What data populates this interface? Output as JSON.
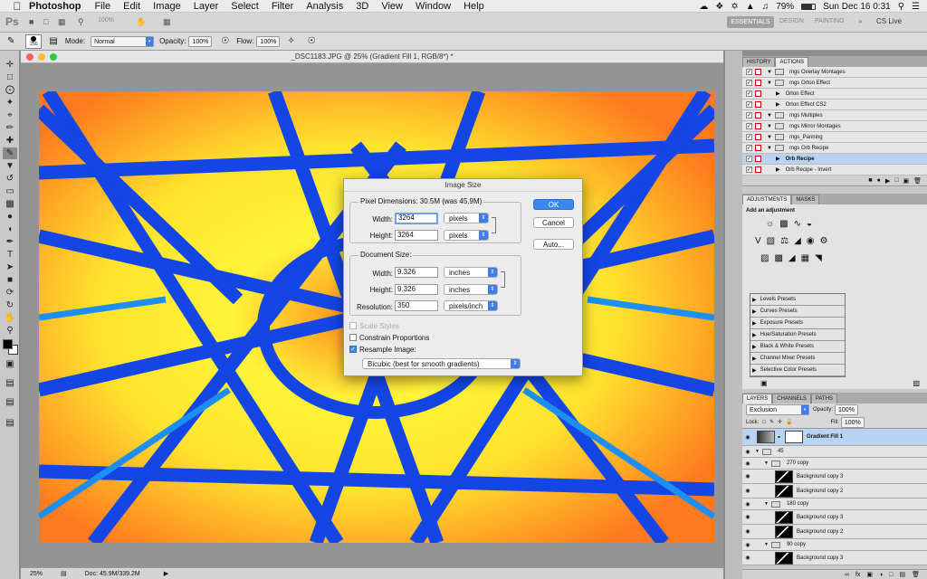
{
  "menubar": {
    "app_name": "Photoshop",
    "items": [
      "File",
      "Edit",
      "Image",
      "Layer",
      "Select",
      "Filter",
      "Analysis",
      "3D",
      "View",
      "Window",
      "Help"
    ],
    "battery": "79%",
    "clock": "Sun Dec 16  0:31"
  },
  "appbar": {
    "ps_logo": "Ps",
    "zoom": "100%",
    "workspaces": [
      "ESSENTIALS",
      "DESIGN",
      "PAINTING"
    ],
    "overflow": "»",
    "cslive": "CS Live"
  },
  "options": {
    "brush_size": "250",
    "mode_label": "Mode:",
    "mode_value": "Normal",
    "opacity_label": "Opacity:",
    "opacity_value": "100%",
    "flow_label": "Flow:",
    "flow_value": "100%"
  },
  "document": {
    "title": "_DSC1183.JPG @ 25% (Gradient Fill 1, RGB/8*) *",
    "zoom": "25%",
    "doc_info": "Doc: 45.9M/339.2M"
  },
  "history_panel": {
    "tabs": [
      "HISTORY",
      "ACTIONS"
    ],
    "rows": [
      {
        "label": "mgs Overlay Montages",
        "level": 0,
        "selected": false
      },
      {
        "label": "mgs Orton Effect",
        "level": 0,
        "selected": false
      },
      {
        "label": "Orton Effect",
        "level": 1,
        "selected": false
      },
      {
        "label": "Orton Effect CS2",
        "level": 1,
        "selected": false
      },
      {
        "label": "mgs Multiples",
        "level": 0,
        "selected": false
      },
      {
        "label": "mgs Mirror Montages",
        "level": 0,
        "selected": false
      },
      {
        "label": "mgs_Panning",
        "level": 0,
        "selected": false
      },
      {
        "label": "mgs Orb Recipe",
        "level": 0,
        "selected": false
      },
      {
        "label": "Orb Recipe",
        "level": 1,
        "selected": true
      },
      {
        "label": "Orb Recipe - Invert",
        "level": 1,
        "selected": false
      }
    ]
  },
  "adjustments_panel": {
    "tabs": [
      "ADJUSTMENTS",
      "MASKS"
    ],
    "heading": "Add an adjustment",
    "presets": [
      "Levels Presets",
      "Curves Presets",
      "Exposure Presets",
      "Hue/Saturation Presets",
      "Black & White Presets",
      "Channel Mixer Presets",
      "Selective Color Presets"
    ]
  },
  "layers_panel": {
    "tabs": [
      "LAYERS",
      "CHANNELS",
      "PATHS"
    ],
    "blend_mode": "Exclusion",
    "opacity_label": "Opacity:",
    "opacity_value": "100%",
    "lock_label": "Lock:",
    "fill_label": "Fill:",
    "fill_value": "100%",
    "layers": [
      {
        "name": "Gradient Fill 1",
        "type": "fill",
        "indent": 0,
        "selected": true
      },
      {
        "name": "45",
        "type": "group",
        "indent": 0,
        "selected": false
      },
      {
        "name": "270 copy",
        "type": "group",
        "indent": 1,
        "selected": false
      },
      {
        "name": "Background copy 3",
        "type": "layer",
        "indent": 2,
        "selected": false
      },
      {
        "name": "Background copy 2",
        "type": "layer",
        "indent": 2,
        "selected": false
      },
      {
        "name": "180 copy",
        "type": "group",
        "indent": 1,
        "selected": false
      },
      {
        "name": "Background copy 3",
        "type": "layer",
        "indent": 2,
        "selected": false
      },
      {
        "name": "Background copy 2",
        "type": "layer",
        "indent": 2,
        "selected": false
      },
      {
        "name": "90 copy",
        "type": "group",
        "indent": 1,
        "selected": false
      },
      {
        "name": "Background copy 3",
        "type": "layer",
        "indent": 2,
        "selected": false
      }
    ]
  },
  "dialog": {
    "title": "Image Size",
    "pixel_dimensions": "Pixel Dimensions:  30.5M (was 45.9M)",
    "width_label": "Width:",
    "width_value": "3264",
    "width_unit": "pixels",
    "height_label": "Height:",
    "height_value": "3264",
    "height_unit": "pixels",
    "document_size_label": "Document Size:",
    "doc_width_label": "Width:",
    "doc_width_value": "9.326",
    "doc_width_unit": "inches",
    "doc_height_label": "Height:",
    "doc_height_value": "9.326",
    "doc_height_unit": "inches",
    "resolution_label": "Resolution:",
    "resolution_value": "350",
    "resolution_unit": "pixels/inch",
    "scale_styles": "Scale Styles",
    "constrain": "Constrain Proportions",
    "resample": "Resample Image:",
    "resample_method": "Bicubic (best for smooth gradients)",
    "ok": "OK",
    "cancel": "Cancel",
    "auto": "Auto..."
  },
  "colors": {
    "accent": "#3b87ef",
    "art_orange": "#ff7a1e",
    "art_yellow": "#fff43a",
    "art_blue": "#1446e6"
  }
}
